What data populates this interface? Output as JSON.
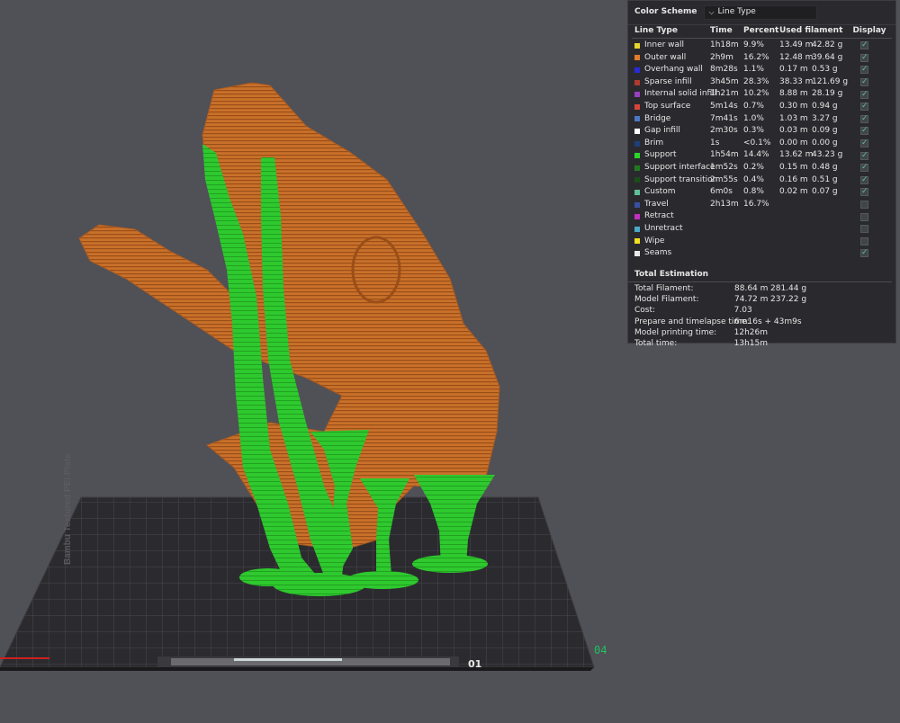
{
  "legend": {
    "scheme_title": "Color Scheme",
    "scheme_value": "Line Type",
    "headers": {
      "line_type": "Line Type",
      "time": "Time",
      "percent": "Percent",
      "used_filament": "Used filament",
      "display": "Display"
    },
    "rows": [
      {
        "name": "Inner wall",
        "time": "1h18m",
        "percent": "9.9%",
        "length": "13.49 m",
        "weight": "42.82 g",
        "color": "#e6d62e",
        "display": true
      },
      {
        "name": "Outer wall",
        "time": "2h9m",
        "percent": "16.2%",
        "length": "12.48 m",
        "weight": "39.64 g",
        "color": "#e07b2a",
        "display": true
      },
      {
        "name": "Overhang wall",
        "time": "8m28s",
        "percent": "1.1%",
        "length": "0.17 m",
        "weight": "0.53 g",
        "color": "#2a2ad4",
        "display": true
      },
      {
        "name": "Sparse infill",
        "time": "3h45m",
        "percent": "28.3%",
        "length": "38.33 m",
        "weight": "121.69 g",
        "color": "#b03a2e",
        "display": true
      },
      {
        "name": "Internal solid infill",
        "time": "1h21m",
        "percent": "10.2%",
        "length": "8.88 m",
        "weight": "28.19 g",
        "color": "#9a3fbf",
        "display": true
      },
      {
        "name": "Top surface",
        "time": "5m14s",
        "percent": "0.7%",
        "length": "0.30 m",
        "weight": "0.94 g",
        "color": "#d6453a",
        "display": true
      },
      {
        "name": "Bridge",
        "time": "7m41s",
        "percent": "1.0%",
        "length": "1.03 m",
        "weight": "3.27 g",
        "color": "#4b78c2",
        "display": true
      },
      {
        "name": "Gap infill",
        "time": "2m30s",
        "percent": "0.3%",
        "length": "0.03 m",
        "weight": "0.09 g",
        "color": "#ffffff",
        "display": true
      },
      {
        "name": "Brim",
        "time": "1s",
        "percent": "<0.1%",
        "length": "0.00 m",
        "weight": "0.00 g",
        "color": "#1d3f7a",
        "display": true
      },
      {
        "name": "Support",
        "time": "1h54m",
        "percent": "14.4%",
        "length": "13.62 m",
        "weight": "43.23 g",
        "color": "#2bd62b",
        "display": true
      },
      {
        "name": "Support interface",
        "time": "1m52s",
        "percent": "0.2%",
        "length": "0.15 m",
        "weight": "0.48 g",
        "color": "#1f7a1f",
        "display": true
      },
      {
        "name": "Support transition",
        "time": "2m55s",
        "percent": "0.4%",
        "length": "0.16 m",
        "weight": "0.51 g",
        "color": "#1a4d1a",
        "display": true
      },
      {
        "name": "Custom",
        "time": "6m0s",
        "percent": "0.8%",
        "length": "0.02 m",
        "weight": "0.07 g",
        "color": "#5fbf9a",
        "display": true
      },
      {
        "name": "Travel",
        "time": "2h13m",
        "percent": "16.7%",
        "length": "",
        "weight": "",
        "color": "#3a4fa0",
        "display": false
      },
      {
        "name": "Retract",
        "time": "",
        "percent": "",
        "length": "",
        "weight": "",
        "color": "#c02fc0",
        "display": false
      },
      {
        "name": "Unretract",
        "time": "",
        "percent": "",
        "length": "",
        "weight": "",
        "color": "#4aa8c8",
        "display": false
      },
      {
        "name": "Wipe",
        "time": "",
        "percent": "",
        "length": "",
        "weight": "",
        "color": "#f0e020",
        "display": false
      },
      {
        "name": "Seams",
        "time": "",
        "percent": "",
        "length": "",
        "weight": "",
        "color": "#e8e8e8",
        "display": true
      }
    ],
    "total_title": "Total Estimation",
    "totals": [
      {
        "label": "Total Filament:",
        "v1": "88.64 m",
        "v2": "281.44 g"
      },
      {
        "label": "Model Filament:",
        "v1": "74.72 m",
        "v2": "237.22 g"
      },
      {
        "label": "Cost:",
        "v1": "7.03",
        "v2": ""
      },
      {
        "label": "Prepare and timelapse time:",
        "v1": "6m16s + 43m9s",
        "v2": ""
      },
      {
        "label": "Model printing time:",
        "v1": "12h26m",
        "v2": ""
      },
      {
        "label": "Total time:",
        "v1": "13h15m",
        "v2": ""
      }
    ]
  },
  "plate": {
    "label": "Bambu Textured PEI Plate",
    "plate_number": "04",
    "bottom_text": "01"
  }
}
